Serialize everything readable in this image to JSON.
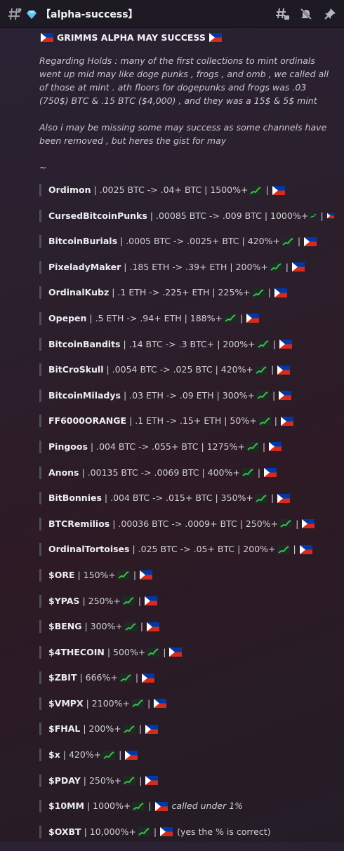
{
  "header": {
    "channel_name": "【alpha-success】",
    "icons": [
      "hash-icon",
      "gem-icon",
      "threads-icon",
      "mute-icon",
      "pin-icon"
    ]
  },
  "post": {
    "headline": "GRIMMS ALPHA MAY SUCCESS",
    "paragraph1": "Regarding Holds : many of the first collections to mint ordinals went up mid may like doge punks , frogs , and omb , we called all of those at mint . ath floors for dogepunks and frogs was .03 (750$) BTC & .15 BTC ($4,000) , and they was a 15$ & 5$ mint",
    "paragraph2": "Also i may be missing some may success as some channels have been removed , but heres the gist for may",
    "tilde": "~"
  },
  "items": [
    {
      "name": "Ordimon",
      "detail": "| .0025 BTC -> .04+ BTC | 1500%+"
    },
    {
      "name": "CursedBitcoinPunks",
      "detail": "| .00085 BTC -> .009 BTC | 1000%+"
    },
    {
      "name": "BitcoinBurials",
      "detail": "| .0005 BTC -> .0025+ BTC | 420%+"
    },
    {
      "name": "PixeladyMaker",
      "detail": "| .185 ETH -> .39+ ETH | 200%+"
    },
    {
      "name": "OrdinalKubz",
      "detail": "| .1 ETH -> .225+ ETH | 225%+"
    },
    {
      "name": "Opepen",
      "detail": "| .5 ETH -> .94+ ETH | 188%+"
    },
    {
      "name": "BitcoinBandits",
      "detail": "| .14 BTC -> .3 BTC+ | 200%+"
    },
    {
      "name": "BitCroSkull",
      "detail": "| .0054 BTC -> .025 BTC | 420%+"
    },
    {
      "name": "BitcoinMiladys",
      "detail": "| .03 ETH -> .09 ETH | 300%+"
    },
    {
      "name": "FF6000ORANGE",
      "detail": "| .1 ETH -> .15+ ETH | 50%+"
    },
    {
      "name": "Pingoos",
      "detail": "| .004 BTC -> .055+ BTC | 1275%+"
    },
    {
      "name": "Anons",
      "detail": "| .00135 BTC -> .0069 BTC | 400%+"
    },
    {
      "name": "BitBonnies",
      "detail": "| .004 BTC -> .015+ BTC | 350%+"
    },
    {
      "name": "BTCRemilios",
      "detail": "| .00036 BTC -> .0009+ BTC | 250%+"
    },
    {
      "name": "OrdinalTortoises",
      "detail": "| .025 BTC -> .05+ BTC | 200%+"
    },
    {
      "name": "$ORE",
      "detail": "| 150%+"
    },
    {
      "name": "$YPAS",
      "detail": "| 250%+"
    },
    {
      "name": "$BENG",
      "detail": "| 300%+"
    },
    {
      "name": "$4THECOIN",
      "detail": "| 500%+"
    },
    {
      "name": "$ZBIT",
      "detail": "| 666%+"
    },
    {
      "name": "$VMPX",
      "detail": "| 2100%+"
    },
    {
      "name": "$FHAL",
      "detail": "| 200%+"
    },
    {
      "name": "$x",
      "detail": "| 420%+"
    },
    {
      "name": "$PDAY",
      "detail": "| 250%+"
    },
    {
      "name": "$10MM",
      "detail": "| 1000%+",
      "note_italic": "called under 1%"
    },
    {
      "name": "$OXBT",
      "detail": "| 10,000%+",
      "note": "(yes the % is correct)"
    }
  ],
  "colors": {
    "accent_green": "#2e8b2e",
    "flag_red": "#d52b1e",
    "flag_blue": "#0038a8"
  }
}
